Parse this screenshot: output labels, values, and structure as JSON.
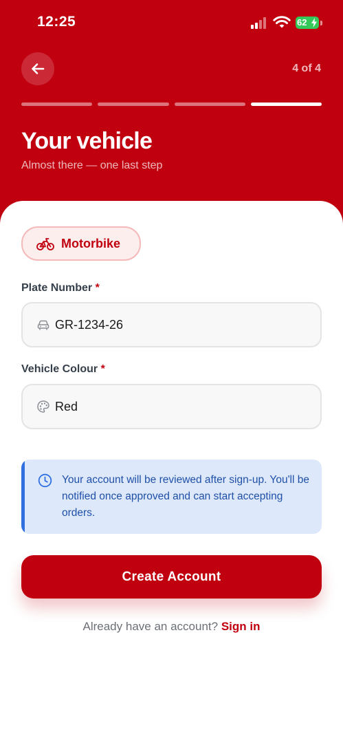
{
  "status_bar": {
    "time": "12:25",
    "battery": "62"
  },
  "header": {
    "step_counter": "4 of 4",
    "title": "Your vehicle",
    "subtitle": "Almost there — one last step",
    "progress": {
      "total_steps": 4,
      "current_step": 4
    }
  },
  "vehicle_type": {
    "label": "Motorbike",
    "icon": "bike-icon"
  },
  "fields": {
    "plate": {
      "label": "Plate Number",
      "required_mark": "*",
      "value": "GR-1234-26",
      "icon": "car-icon"
    },
    "colour": {
      "label": "Vehicle Colour",
      "required_mark": "*",
      "value": "Red",
      "icon": "palette-icon"
    }
  },
  "info": {
    "icon": "clock-icon",
    "text": "Your account will be reviewed after sign-up. You'll be notified once approved and can start accepting orders."
  },
  "actions": {
    "create_account": "Create Account",
    "signin_prompt": "Already have an account?",
    "signin_link": "Sign in"
  },
  "colors": {
    "brand_red": "#c1000f",
    "info_blue": "#2f6fe0",
    "info_background": "#dde9fb"
  }
}
